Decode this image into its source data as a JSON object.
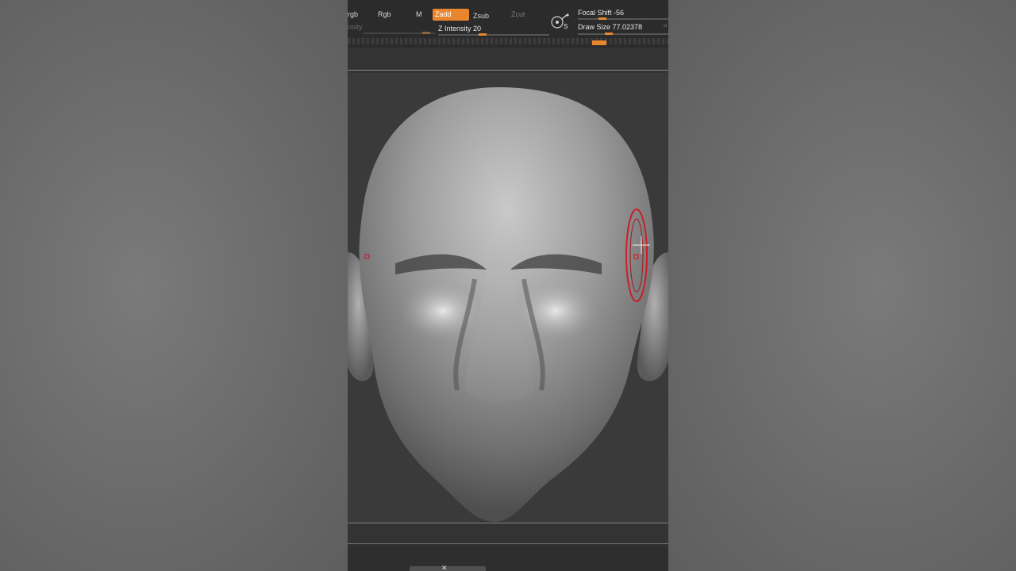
{
  "toolbar": {
    "rgb_channel": "rgb",
    "rgb": "Rgb",
    "m": "M",
    "zadd": "Zadd",
    "zsub": "Zsub",
    "zcut": "Zcut",
    "intensity_faded": "nsity",
    "z_intensity_label": "Z Intensity 20",
    "focal_shift_label": "Focal Shift -56",
    "draw_size_label": "Draw Size",
    "draw_size_value": "77.02378",
    "gizmo_letter": "S"
  },
  "sliders": {
    "z_intensity": 20,
    "focal_shift": -56
  },
  "colors": {
    "accent": "#e9862d",
    "panel": "#2b2b2b",
    "canvas": "#3a3a3a",
    "brush_ring": "#c8202a"
  },
  "icons": {
    "gizmo": "gizmo-icon",
    "cursor": "crosshair-icon",
    "brush": "brush-cursor-icon"
  }
}
